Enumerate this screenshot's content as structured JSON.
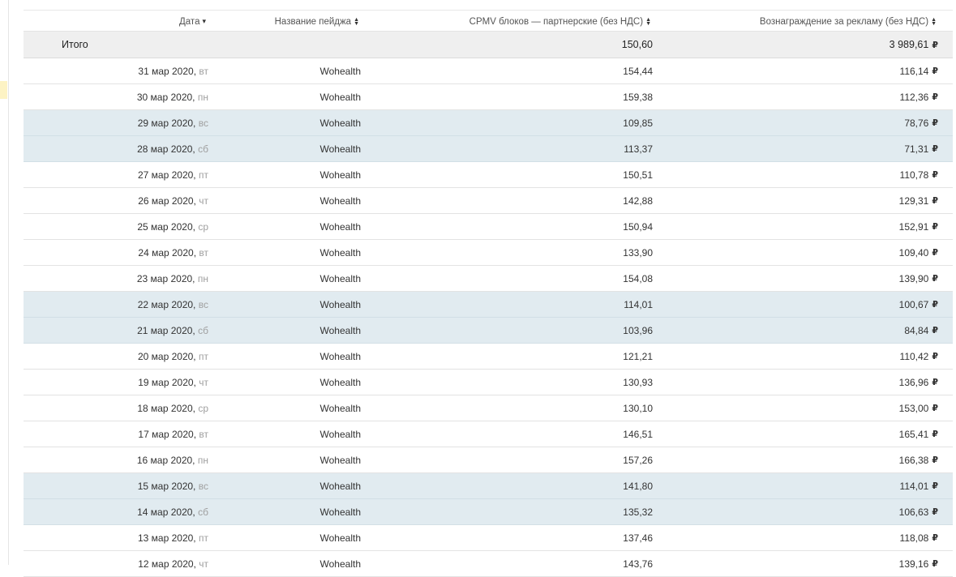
{
  "header": {
    "date_label": "Дата",
    "page_label": "Название пейджа",
    "cpmv_label": "CPMV блоков — партнерские (без НДС)",
    "revenue_label": "Вознаграждение за рекламу (без НДС)",
    "sort_desc_glyph": "▾",
    "sort_up_glyph": "▲",
    "sort_down_glyph": "▼"
  },
  "total": {
    "label": "Итого",
    "cpmv": "150,60",
    "revenue": "3 989,61"
  },
  "currency": "₽",
  "colors": {
    "weekend_row": "#e1ebf0",
    "total_row": "#efefef",
    "day_of_week": "#a0a0a0"
  },
  "rows": [
    {
      "date": "31 мар 2020,",
      "dow": "вт",
      "page": "Wohealth",
      "cpmv": "154,44",
      "revenue": "116,14",
      "weekend": false
    },
    {
      "date": "30 мар 2020,",
      "dow": "пн",
      "page": "Wohealth",
      "cpmv": "159,38",
      "revenue": "112,36",
      "weekend": false
    },
    {
      "date": "29 мар 2020,",
      "dow": "вс",
      "page": "Wohealth",
      "cpmv": "109,85",
      "revenue": "78,76",
      "weekend": true
    },
    {
      "date": "28 мар 2020,",
      "dow": "сб",
      "page": "Wohealth",
      "cpmv": "113,37",
      "revenue": "71,31",
      "weekend": true
    },
    {
      "date": "27 мар 2020,",
      "dow": "пт",
      "page": "Wohealth",
      "cpmv": "150,51",
      "revenue": "110,78",
      "weekend": false
    },
    {
      "date": "26 мар 2020,",
      "dow": "чт",
      "page": "Wohealth",
      "cpmv": "142,88",
      "revenue": "129,31",
      "weekend": false
    },
    {
      "date": "25 мар 2020,",
      "dow": "ср",
      "page": "Wohealth",
      "cpmv": "150,94",
      "revenue": "152,91",
      "weekend": false
    },
    {
      "date": "24 мар 2020,",
      "dow": "вт",
      "page": "Wohealth",
      "cpmv": "133,90",
      "revenue": "109,40",
      "weekend": false
    },
    {
      "date": "23 мар 2020,",
      "dow": "пн",
      "page": "Wohealth",
      "cpmv": "154,08",
      "revenue": "139,90",
      "weekend": false
    },
    {
      "date": "22 мар 2020,",
      "dow": "вс",
      "page": "Wohealth",
      "cpmv": "114,01",
      "revenue": "100,67",
      "weekend": true
    },
    {
      "date": "21 мар 2020,",
      "dow": "сб",
      "page": "Wohealth",
      "cpmv": "103,96",
      "revenue": "84,84",
      "weekend": true
    },
    {
      "date": "20 мар 2020,",
      "dow": "пт",
      "page": "Wohealth",
      "cpmv": "121,21",
      "revenue": "110,42",
      "weekend": false
    },
    {
      "date": "19 мар 2020,",
      "dow": "чт",
      "page": "Wohealth",
      "cpmv": "130,93",
      "revenue": "136,96",
      "weekend": false
    },
    {
      "date": "18 мар 2020,",
      "dow": "ср",
      "page": "Wohealth",
      "cpmv": "130,10",
      "revenue": "153,00",
      "weekend": false
    },
    {
      "date": "17 мар 2020,",
      "dow": "вт",
      "page": "Wohealth",
      "cpmv": "146,51",
      "revenue": "165,41",
      "weekend": false
    },
    {
      "date": "16 мар 2020,",
      "dow": "пн",
      "page": "Wohealth",
      "cpmv": "157,26",
      "revenue": "166,38",
      "weekend": false
    },
    {
      "date": "15 мар 2020,",
      "dow": "вс",
      "page": "Wohealth",
      "cpmv": "141,80",
      "revenue": "114,01",
      "weekend": true
    },
    {
      "date": "14 мар 2020,",
      "dow": "сб",
      "page": "Wohealth",
      "cpmv": "135,32",
      "revenue": "106,63",
      "weekend": true
    },
    {
      "date": "13 мар 2020,",
      "dow": "пт",
      "page": "Wohealth",
      "cpmv": "137,46",
      "revenue": "118,08",
      "weekend": false
    },
    {
      "date": "12 мар 2020,",
      "dow": "чт",
      "page": "Wohealth",
      "cpmv": "143,76",
      "revenue": "139,16",
      "weekend": false
    }
  ]
}
